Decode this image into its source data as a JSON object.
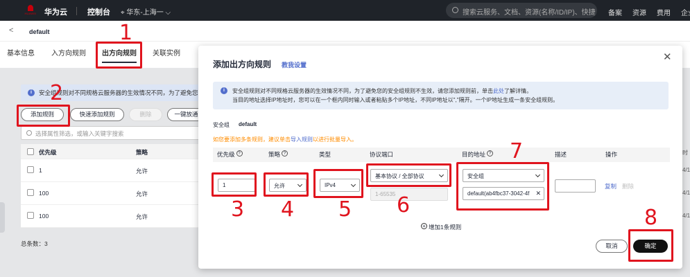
{
  "topbar": {
    "logo_text": "HUAWEI",
    "brand": "华为云",
    "console": "控制台",
    "region": "⌖ 华东-上海一 ⌵",
    "search_placeholder": "搜索云服务、文档、资源(名称/ID/IP)、快捷...",
    "nav": [
      "备案",
      "资源",
      "费用",
      "企业"
    ]
  },
  "breadcrumb": {
    "back": "<",
    "title": "default"
  },
  "tabs": [
    "基本信息",
    "入方向规则",
    "出方向规则",
    "关联实例"
  ],
  "background": {
    "info_text": "安全组规则对不同规格云服务器的生效情况不同，为了避免您的安",
    "buttons": {
      "add": "添加规则",
      "quick_add": "快速添加规则",
      "delete": "删除",
      "one_click": "一键放通"
    },
    "filter_placeholder": "选择属性筛选，或输入关键字搜索",
    "columns": [
      "优先级",
      "策略"
    ],
    "rows": [
      {
        "priority": "1",
        "policy": "允许"
      },
      {
        "priority": "100",
        "policy": "允许"
      },
      {
        "priority": "100",
        "policy": "允许"
      }
    ],
    "total": "总条数：3",
    "right_cut": [
      "时",
      "4/1",
      "4/1",
      "4/1"
    ]
  },
  "modal": {
    "title": "添加出方向规则",
    "tutorial": "教我设置",
    "info_pre": "安全组规则对不同规格云服务器的生效情况不同，为了避免您的安全组规则不生效，请您添加规则前，单击",
    "info_link": "此处",
    "info_post": "了解详情。",
    "info_line2": "当目的地址选择IP地址时，您可以在一个框内同时输入或者粘贴多个IP地址，不同IP地址以\",\"隔开。一个IP地址生成一条安全组规则。",
    "sg_label": "安全组",
    "sg_value": "default",
    "tip_pre": "如您要添加多条规则，建议单击",
    "tip_link": "导入规则",
    "tip_post": "以进行批量导入。",
    "columns": {
      "priority": "优先级",
      "policy": "策略",
      "type": "类型",
      "protocol": "协议端口",
      "dest": "目的地址",
      "desc": "描述",
      "action": "操作"
    },
    "row": {
      "priority": "1",
      "policy": "允许",
      "type": "IPv4",
      "protocol": "基本协议 / 全部协议",
      "port_placeholder": "1-65535",
      "dest_type": "安全组",
      "dest_value": "default(ab4fbc37-3042-4f",
      "copy": "复制",
      "delete": "删除"
    },
    "add_rule": "增加1条规则",
    "cancel": "取消",
    "confirm": "确定"
  },
  "annotations": [
    "1",
    "2",
    "3",
    "4",
    "5",
    "6",
    "7",
    "8"
  ],
  "colors": {
    "annotation": "#e0141e",
    "link": "#526ecc",
    "tip": "#ff8c00",
    "topbar": "#1f2329"
  }
}
